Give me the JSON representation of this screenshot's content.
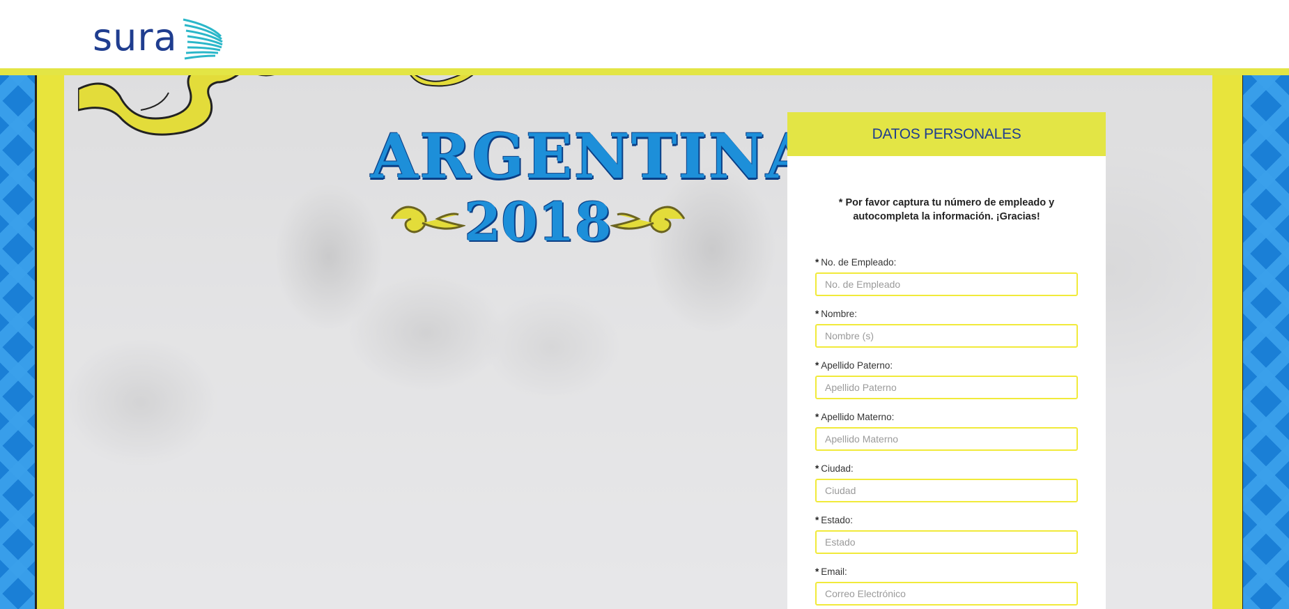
{
  "header": {
    "logo_text": "sura",
    "brand_color": "#1f3d8f",
    "accent_color": "#e3e545"
  },
  "hero": {
    "title": "ARGENTINA",
    "year": "2018",
    "title_color": "#1d8fd9"
  },
  "form": {
    "heading": "DATOS PERSONALES",
    "note_line1": "* Por favor captura tu número de empleado y",
    "note_line2": "autocompleta la información. ¡Gracias!",
    "required_mark": "*",
    "fields": [
      {
        "label": "No. de Empleado:",
        "placeholder": "No. de Empleado",
        "value": ""
      },
      {
        "label": "Nombre:",
        "placeholder": "Nombre (s)",
        "value": ""
      },
      {
        "label": "Apellido Paterno:",
        "placeholder": "Apellido Paterno",
        "value": ""
      },
      {
        "label": "Apellido Materno:",
        "placeholder": "Apellido Materno",
        "value": ""
      },
      {
        "label": "Ciudad:",
        "placeholder": "Ciudad",
        "value": ""
      },
      {
        "label": "Estado:",
        "placeholder": "Estado",
        "value": ""
      },
      {
        "label": "Email:",
        "placeholder": "Correo Electrónico",
        "value": ""
      }
    ]
  }
}
